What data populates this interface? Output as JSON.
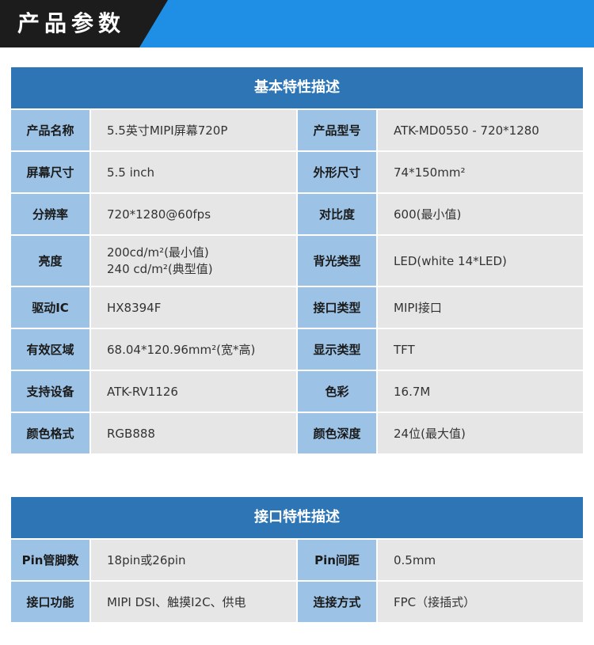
{
  "banner": {
    "title": "产品参数"
  },
  "basic": {
    "title": "基本特性描述",
    "rows": [
      {
        "l1": "产品名称",
        "v1": "5.5英寸MIPI屏幕720P",
        "l2": "产品型号",
        "v2": "ATK-MD0550 - 720*1280"
      },
      {
        "l1": "屏幕尺寸",
        "v1": "5.5 inch",
        "l2": "外形尺寸",
        "v2": "74*150mm²"
      },
      {
        "l1": "分辨率",
        "v1": "720*1280@60fps",
        "l2": "对比度",
        "v2": "600(最小值)"
      },
      {
        "l1": "亮度",
        "v1a": "200cd/m²(最小值)",
        "v1b": "240 cd/m²(典型值)",
        "l2": "背光类型",
        "v2": "LED(white 14*LED)"
      },
      {
        "l1": "驱动IC",
        "v1": "HX8394F",
        "l2": "接口类型",
        "v2": "MIPI接口"
      },
      {
        "l1": "有效区域",
        "v1": "68.04*120.96mm²(宽*高)",
        "l2": "显示类型",
        "v2": "TFT"
      },
      {
        "l1": "支持设备",
        "v1": "ATK-RV1126",
        "l2": "色彩",
        "v2": "16.7M"
      },
      {
        "l1": "颜色格式",
        "v1": "RGB888",
        "l2": "颜色深度",
        "v2": "24位(最大值)"
      }
    ]
  },
  "interface": {
    "title": "接口特性描述",
    "rows": [
      {
        "l1": "Pin管脚数",
        "v1": "18pin或26pin",
        "l2": "Pin间距",
        "v2": "0.5mm"
      },
      {
        "l1": "接口功能",
        "v1": "MIPI DSI、触摸I2C、供电",
        "l2": "连接方式",
        "v2": "FPC（接插式）"
      }
    ]
  },
  "colors": {
    "banner_blue": "#1f8fe6",
    "banner_dark": "#1c1c1c",
    "header_blue": "#2e75b6",
    "label_blue": "#9cc2e5",
    "value_gray": "#e6e6e6"
  }
}
